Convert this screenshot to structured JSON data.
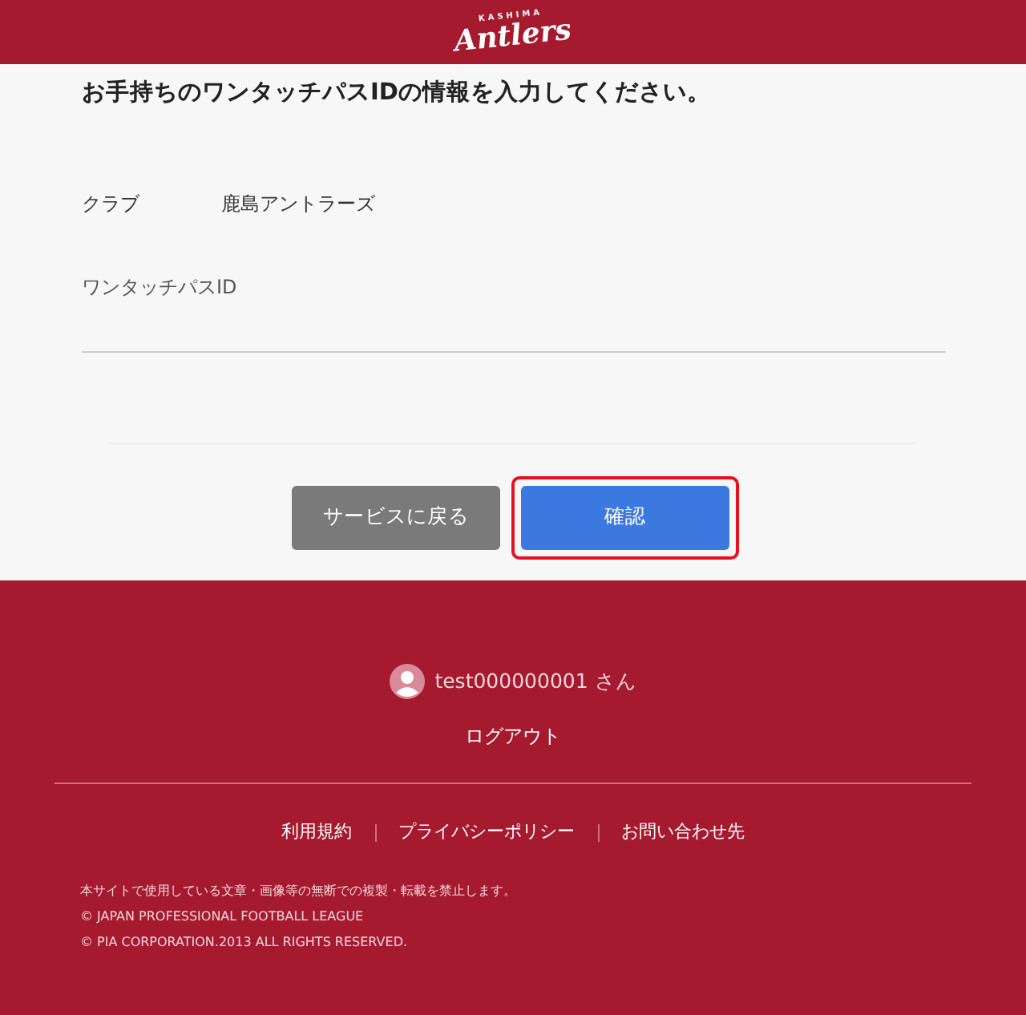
{
  "header": {
    "logo_small": "KASHIMA",
    "logo": "Antlers"
  },
  "form": {
    "heading": "お手持ちのワンタッチパスIDの情報を入力してください。",
    "club_label": "クラブ",
    "club_value": "鹿島アントラーズ",
    "id_label": "ワンタッチパスID",
    "buttons": [
      {
        "kind": "secondary",
        "label": "サービスに戻る",
        "focused": false
      },
      {
        "kind": "primary",
        "label": "確認",
        "focused": true
      }
    ]
  },
  "footer": {
    "user": "test000000001 さん",
    "logout": "ログアウト",
    "links": [
      "利用規約",
      "プライバシーポリシー",
      "お問い合わせ先"
    ],
    "notes": [
      "本サイトで使用している文章・画像等の無断での複製・転載を禁止します。",
      "© JAPAN PROFESSIONAL FOOTBALL LEAGUE",
      "© PIA CORPORATION.2013 ALL RIGHTS RESERVED."
    ]
  }
}
